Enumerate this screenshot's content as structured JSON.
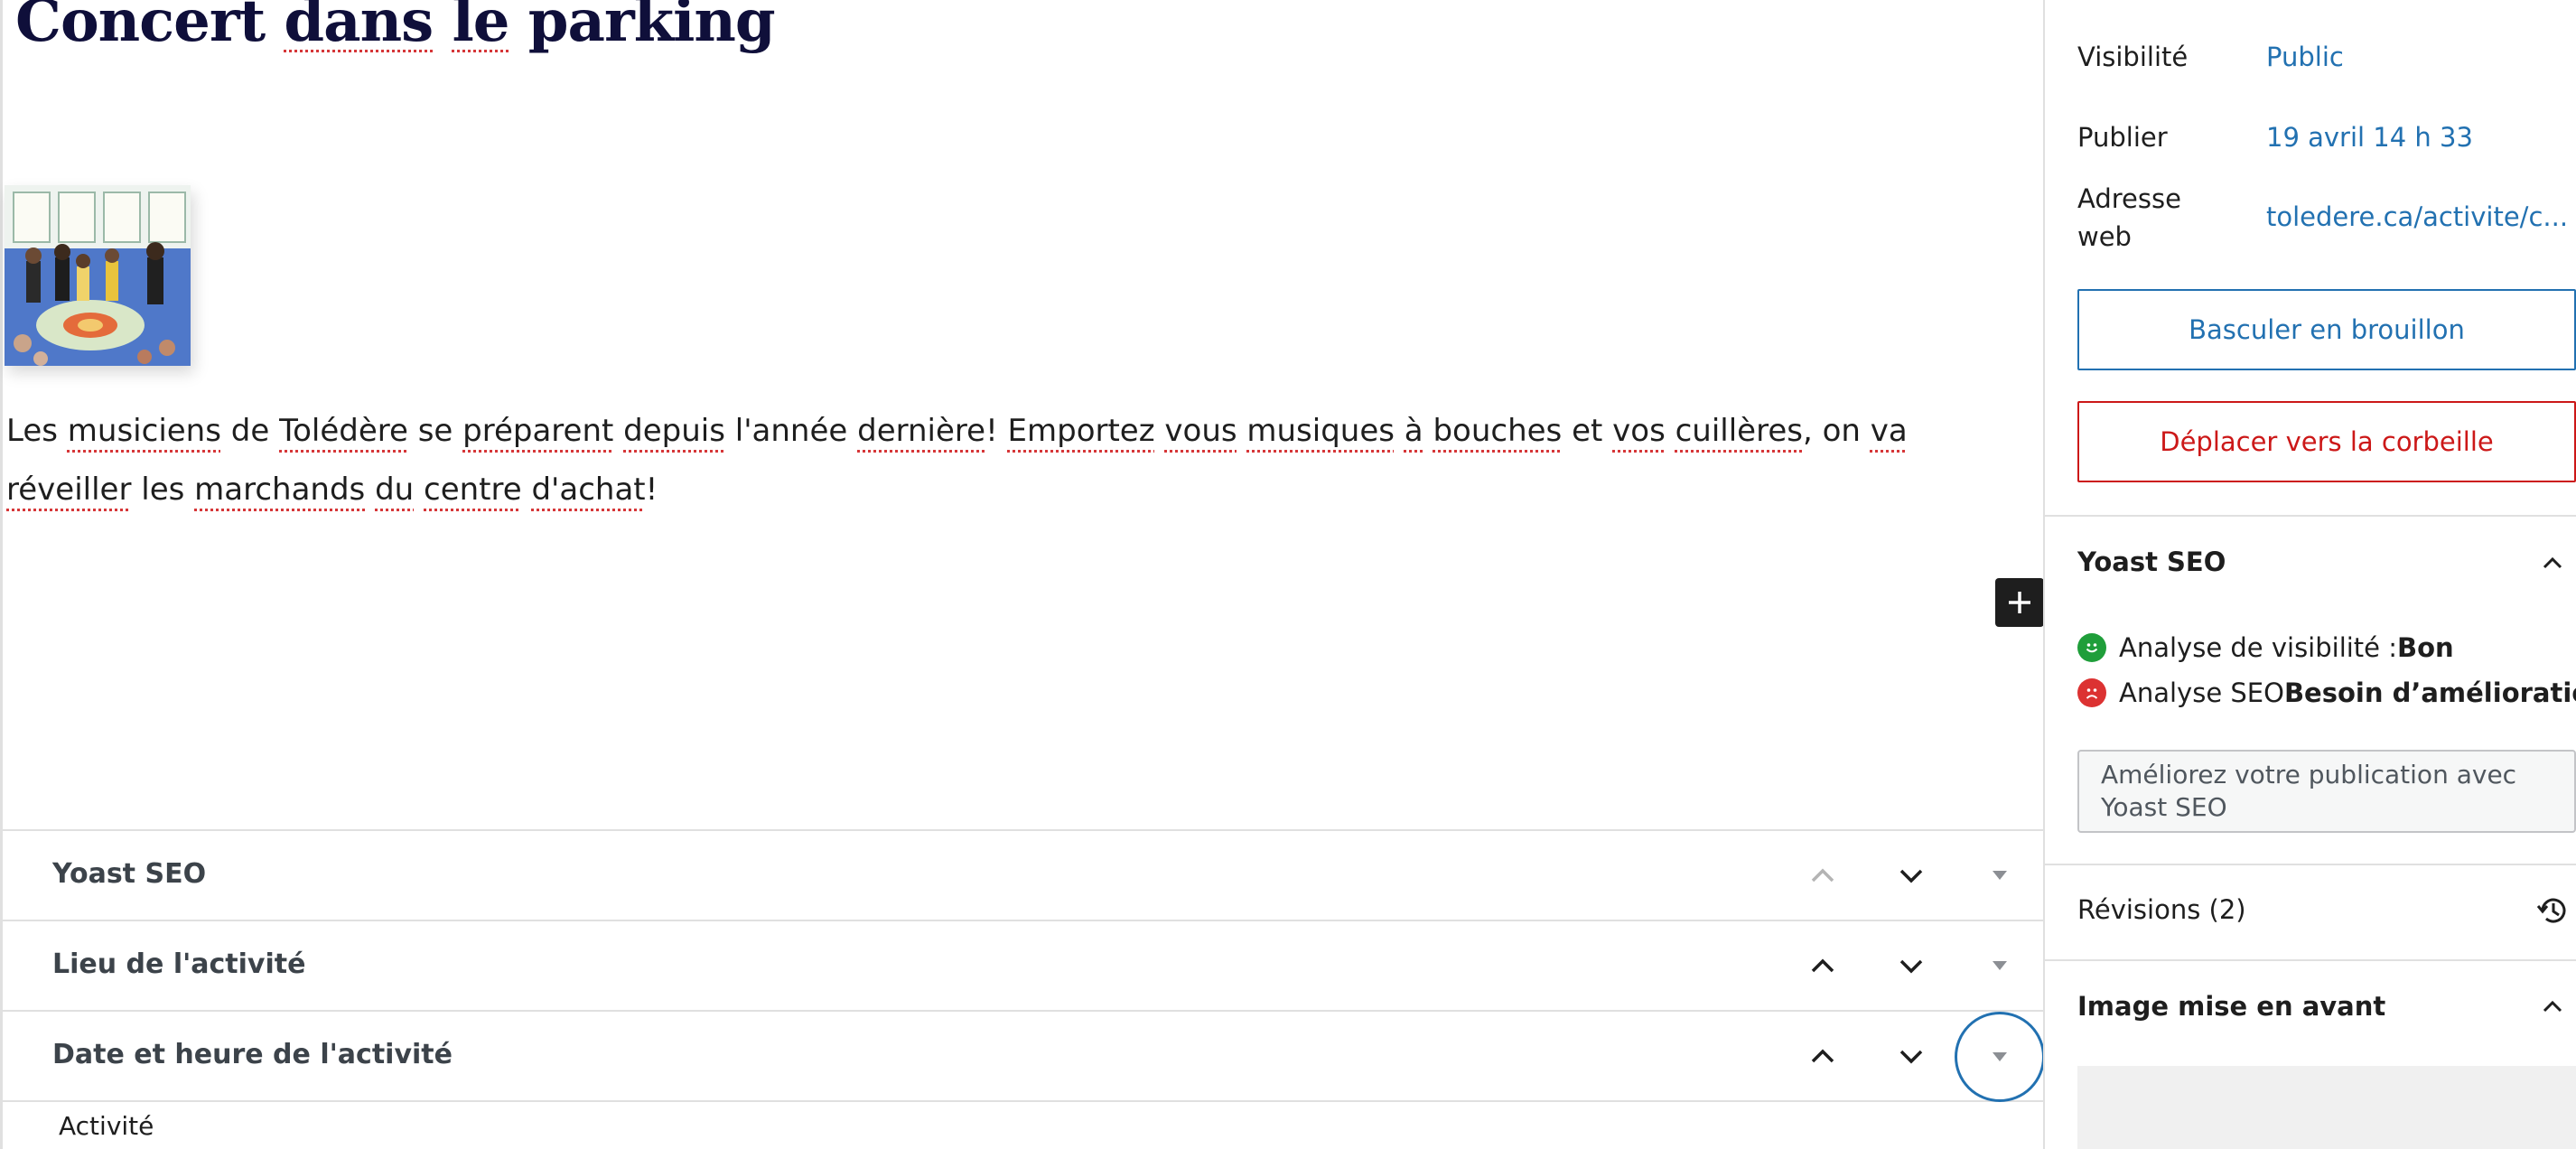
{
  "editor": {
    "title_parts": [
      "Concert ",
      "dans",
      " ",
      "le",
      " parking"
    ],
    "paragraph_parts": [
      "Les ",
      "musiciens",
      " de ",
      "Tolédère",
      " se ",
      "préparent",
      " ",
      "depuis",
      " l'année ",
      "dernière",
      "! ",
      "Emportez",
      " ",
      "vous",
      " ",
      "musiques",
      " ",
      "à",
      " ",
      "bouches",
      " et ",
      "vos",
      " ",
      "cuillères",
      ", on ",
      "va",
      " ",
      "réveiller",
      " les ",
      "marchands",
      " ",
      "du",
      " ",
      "centre",
      " ",
      "d'achat",
      "!"
    ],
    "featured_thumb_alt": "photo d'activité"
  },
  "metaboxes": [
    {
      "title": "Yoast SEO"
    },
    {
      "title": "Lieu de l'activité"
    },
    {
      "title": "Date et heure de l'activité"
    }
  ],
  "bottom_label": "Activité",
  "sidebar": {
    "visibility_label": "Visibilité",
    "visibility_value": "Public",
    "publish_label": "Publier",
    "publish_value": "19 avril 14 h 33",
    "url_label_line1": "Adresse",
    "url_label_line2": "web",
    "url_value": "toledere.ca/activite/c...",
    "switch_draft_button": "Basculer en brouillon",
    "trash_button": "Déplacer vers la corbeille",
    "yoast_panel_title": "Yoast SEO",
    "readability_label": "Analyse de visibilité : ",
    "readability_value": "Bon",
    "seo_label": "Analyse SEO ",
    "seo_value": "Besoin d’amélioration",
    "yoast_improve_button": "Améliorez votre publication avec Yoast SEO",
    "revisions_label": "Révisions (2)",
    "featured_image_title": "Image mise en avant"
  },
  "colors": {
    "accent": "#2271b1",
    "danger": "#cc1818",
    "good": "#1f9e3a",
    "bad": "#dc3232",
    "title": "#0f0f3a"
  }
}
